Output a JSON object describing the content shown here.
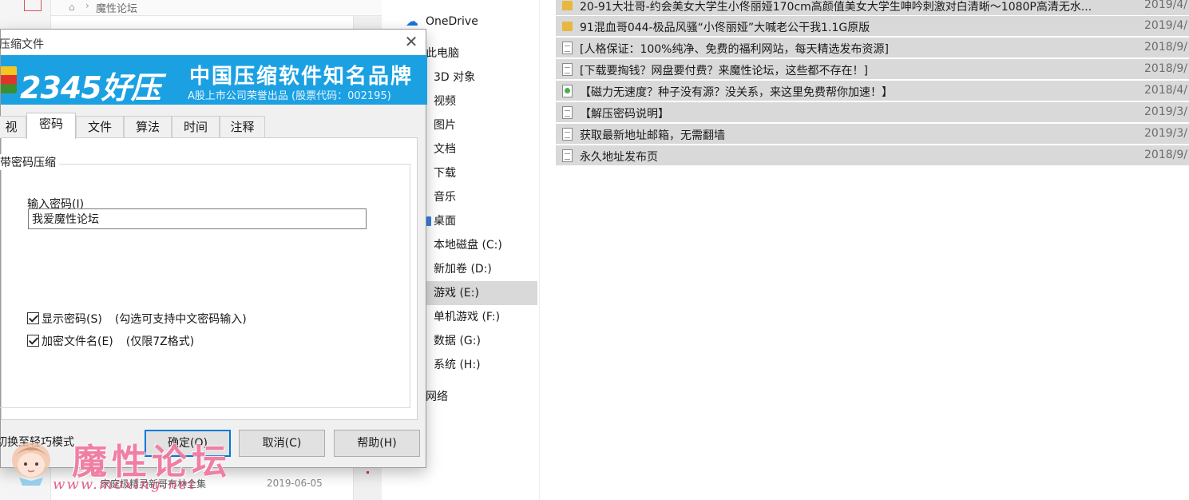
{
  "explorer_bg": {
    "breadcrumb": "魔性论坛",
    "row_name": "家庭极精灵新哥布林全集",
    "row_date": "2019-06-05"
  },
  "nav": {
    "items": [
      {
        "label": "OneDrive",
        "icon": "cloud-icon"
      },
      {
        "label": "此电脑",
        "icon": "computer-icon"
      },
      {
        "label": "3D 对象",
        "icon": "folder-icon"
      },
      {
        "label": "视频",
        "icon": "folder-icon"
      },
      {
        "label": "图片",
        "icon": "folder-icon"
      },
      {
        "label": "文档",
        "icon": "folder-icon"
      },
      {
        "label": "下载",
        "icon": "folder-icon"
      },
      {
        "label": "音乐",
        "icon": "folder-icon"
      },
      {
        "label": "桌面",
        "icon": "folder-icon"
      },
      {
        "label": "本地磁盘 (C:)",
        "icon": "drive-icon"
      },
      {
        "label": "新加卷 (D:)",
        "icon": "drive-icon"
      },
      {
        "label": "游戏 (E:)",
        "icon": "drive-icon",
        "selected": true
      },
      {
        "label": "单机游戏 (F:)",
        "icon": "drive-icon"
      },
      {
        "label": "数据 (G:)",
        "icon": "drive-icon"
      },
      {
        "label": "系统 (H:)",
        "icon": "drive-icon"
      },
      {
        "label": "网络",
        "icon": "network-icon"
      }
    ]
  },
  "files": [
    {
      "name": "20-91大壮哥-约会美女大学生小佟丽娅170cm高颜值美女大学生呻吟刺激对白清晰～1080P高清无水...",
      "date": "2019/4/",
      "type": "folder"
    },
    {
      "name": "91混血哥044-极品风骚“小佟丽娅”大喊老公干我1.1G原版",
      "date": "2019/4/",
      "type": "folder"
    },
    {
      "name": "[人格保证：100%纯净、免费的福利网站，每天精选发布资源]",
      "date": "2018/9/",
      "type": "doc"
    },
    {
      "name": "[下载要掏钱？网盘要付费？来魔性论坛，这些都不存在！]",
      "date": "2018/9/",
      "type": "doc"
    },
    {
      "name": "【磁力无速度？种子没有源？没关系，来这里免费帮你加速！】",
      "date": "2018/4/",
      "type": "link"
    },
    {
      "name": "【解压密码说明】",
      "date": "2019/3/",
      "type": "doc"
    },
    {
      "name": "获取最新地址邮箱，无需翻墙",
      "date": "2019/3/",
      "type": "doc"
    },
    {
      "name": "永久地址发布页",
      "date": "2018/9/",
      "type": "doc"
    }
  ],
  "dialog": {
    "title": "压缩文件",
    "banner": {
      "brand": "2345好压",
      "slogan": "中国压缩软件知名品牌",
      "subtitle": "A股上市公司荣誉出品 (股票代码：002195)"
    },
    "tabs": [
      {
        "label": "视"
      },
      {
        "label": "密码",
        "active": true
      },
      {
        "label": "文件"
      },
      {
        "label": "算法"
      },
      {
        "label": "时间"
      },
      {
        "label": "注释"
      }
    ],
    "group_title": "带密码压缩",
    "password_label": "输入密码(I)",
    "password_value": "我爱魔性论坛",
    "show_password": {
      "label": "显示密码(S)",
      "hint": "(勾选可支持中文密码输入)",
      "checked": true
    },
    "encrypt_names": {
      "label": "加密文件名(E)",
      "hint": "(仅限7Z格式)",
      "checked": true
    },
    "buttons": {
      "switch_mode": "切换至轻巧模式",
      "ok": "确定(O)",
      "cancel": "取消(C)",
      "help": "帮助(H)"
    }
  },
  "watermark": {
    "text": "魔性论坛",
    "url": "www.moxing.net"
  },
  "colors": {
    "banner_blue": "#1ba1e2",
    "selection_gray": "#d9d9d9",
    "primary_button_border": "#0078d7",
    "watermark_pink": "#f07aa0"
  }
}
